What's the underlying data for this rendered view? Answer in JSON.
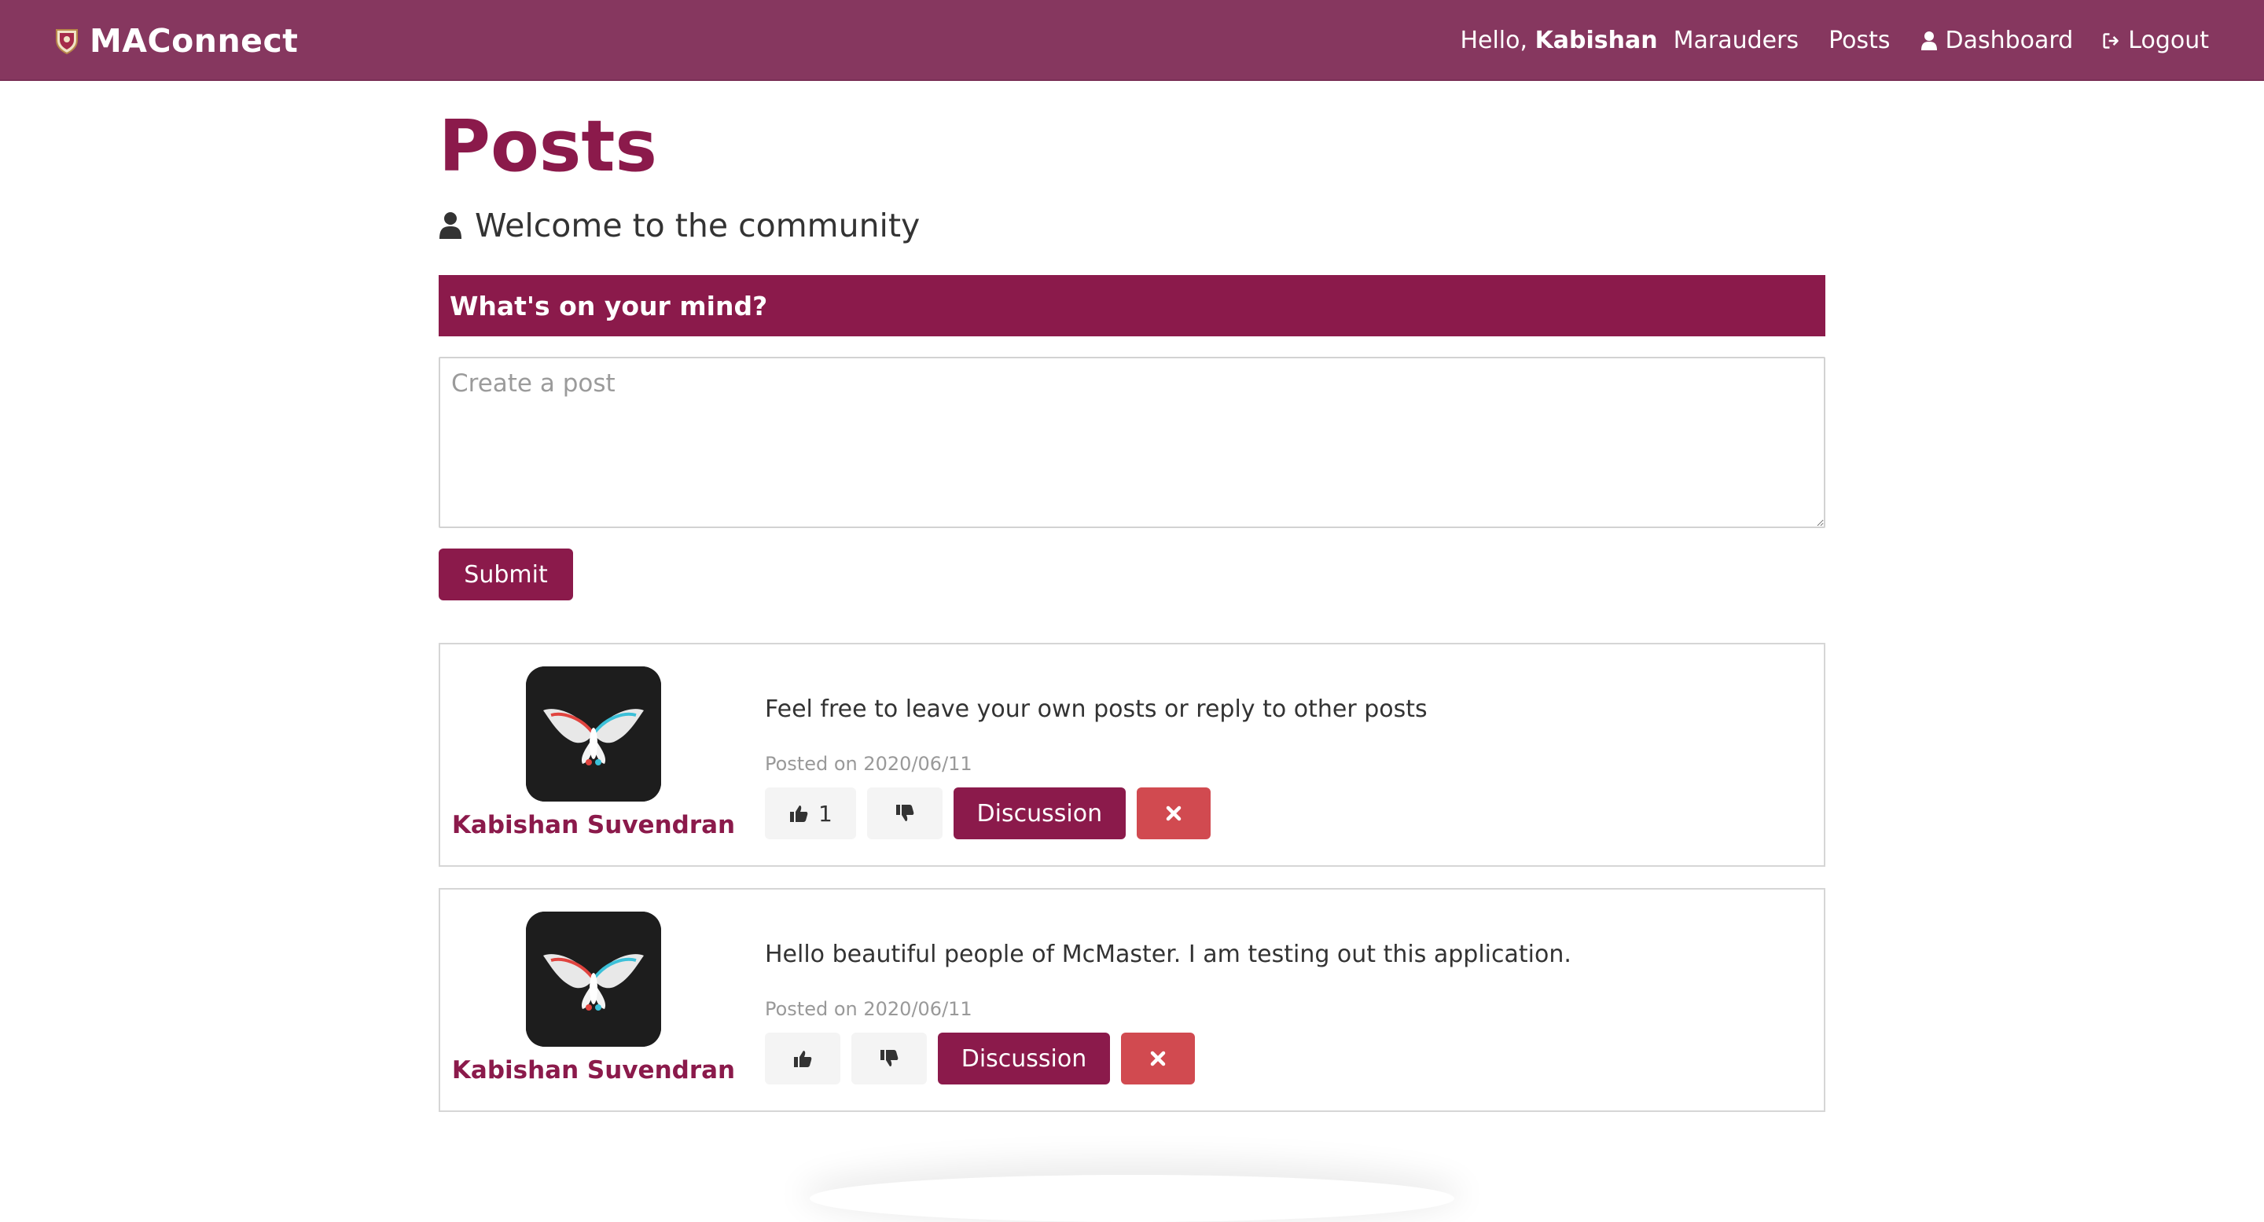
{
  "navbar": {
    "brand": "MAConnect",
    "hello_prefix": "Hello,",
    "user_name": "Kabishan",
    "links": {
      "marauders": "Marauders",
      "posts": "Posts",
      "dashboard": "Dashboard",
      "logout": "Logout"
    },
    "background_color": "#86375f"
  },
  "main": {
    "title": "Posts",
    "lead": "Welcome to the community",
    "compose": {
      "header": "What's on your mind?",
      "placeholder": "Create a post",
      "value": "",
      "submit_label": "Submit"
    },
    "accent_color": "#8b1a4b",
    "danger_color": "#d14a50"
  },
  "posts": [
    {
      "author": "Kabishan Suvendran",
      "text": "Feel free to leave your own posts or reply to other posts",
      "date": "Posted on 2020/06/11",
      "likes": "1",
      "discussion_label": "Discussion"
    },
    {
      "author": "Kabishan Suvendran",
      "text": "Hello beautiful people of McMaster. I am testing out this application.",
      "date": "Posted on 2020/06/11",
      "likes": "",
      "discussion_label": "Discussion"
    }
  ],
  "icons": {
    "brand": "shield-crest-icon",
    "dashboard": "user-icon",
    "logout": "sign-out-icon",
    "lead": "user-icon",
    "like": "thumbs-up-icon",
    "dislike": "thumbs-down-icon",
    "delete": "close-icon",
    "avatar": "butterfly-avatar"
  }
}
